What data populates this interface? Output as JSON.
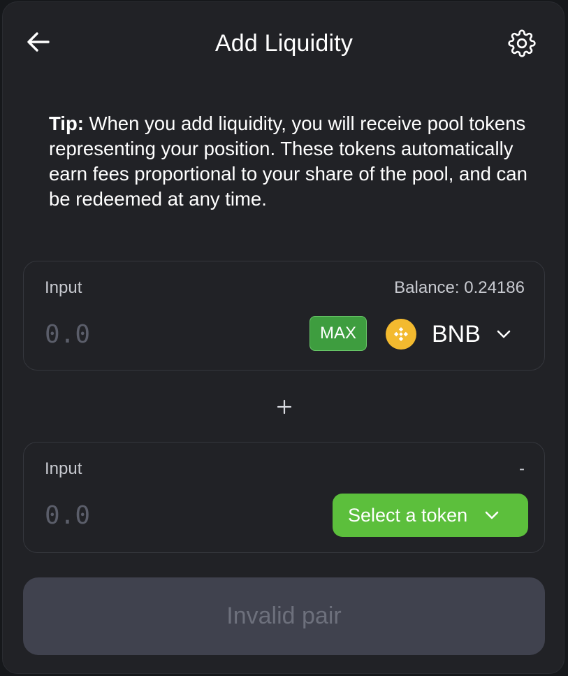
{
  "header": {
    "title": "Add Liquidity",
    "back_icon": "arrow-left-icon",
    "settings_icon": "gear-icon"
  },
  "tip": {
    "label": "Tip:",
    "text": " When you add liquidity, you will receive pool tokens representing your position. These tokens automatically earn fees proportional to your share of the pool, and can be redeemed at any time."
  },
  "input_a": {
    "label": "Input",
    "balance": "Balance: 0.24186",
    "placeholder": "0.0",
    "max_label": "MAX",
    "token_symbol": "BNB",
    "token_icon": "bnb-logo-icon"
  },
  "separator_icon": "plus-icon",
  "input_b": {
    "label": "Input",
    "balance": "-",
    "placeholder": "0.0",
    "select_label": "Select a token"
  },
  "submit": {
    "label": "Invalid pair"
  },
  "colors": {
    "card_bg": "#212226",
    "accent_green": "#5cbf3c",
    "max_green": "#3e9d3f",
    "bnb_yellow": "#f3ba2f",
    "disabled_btn": "#40424e",
    "disabled_text": "#6d707c"
  }
}
